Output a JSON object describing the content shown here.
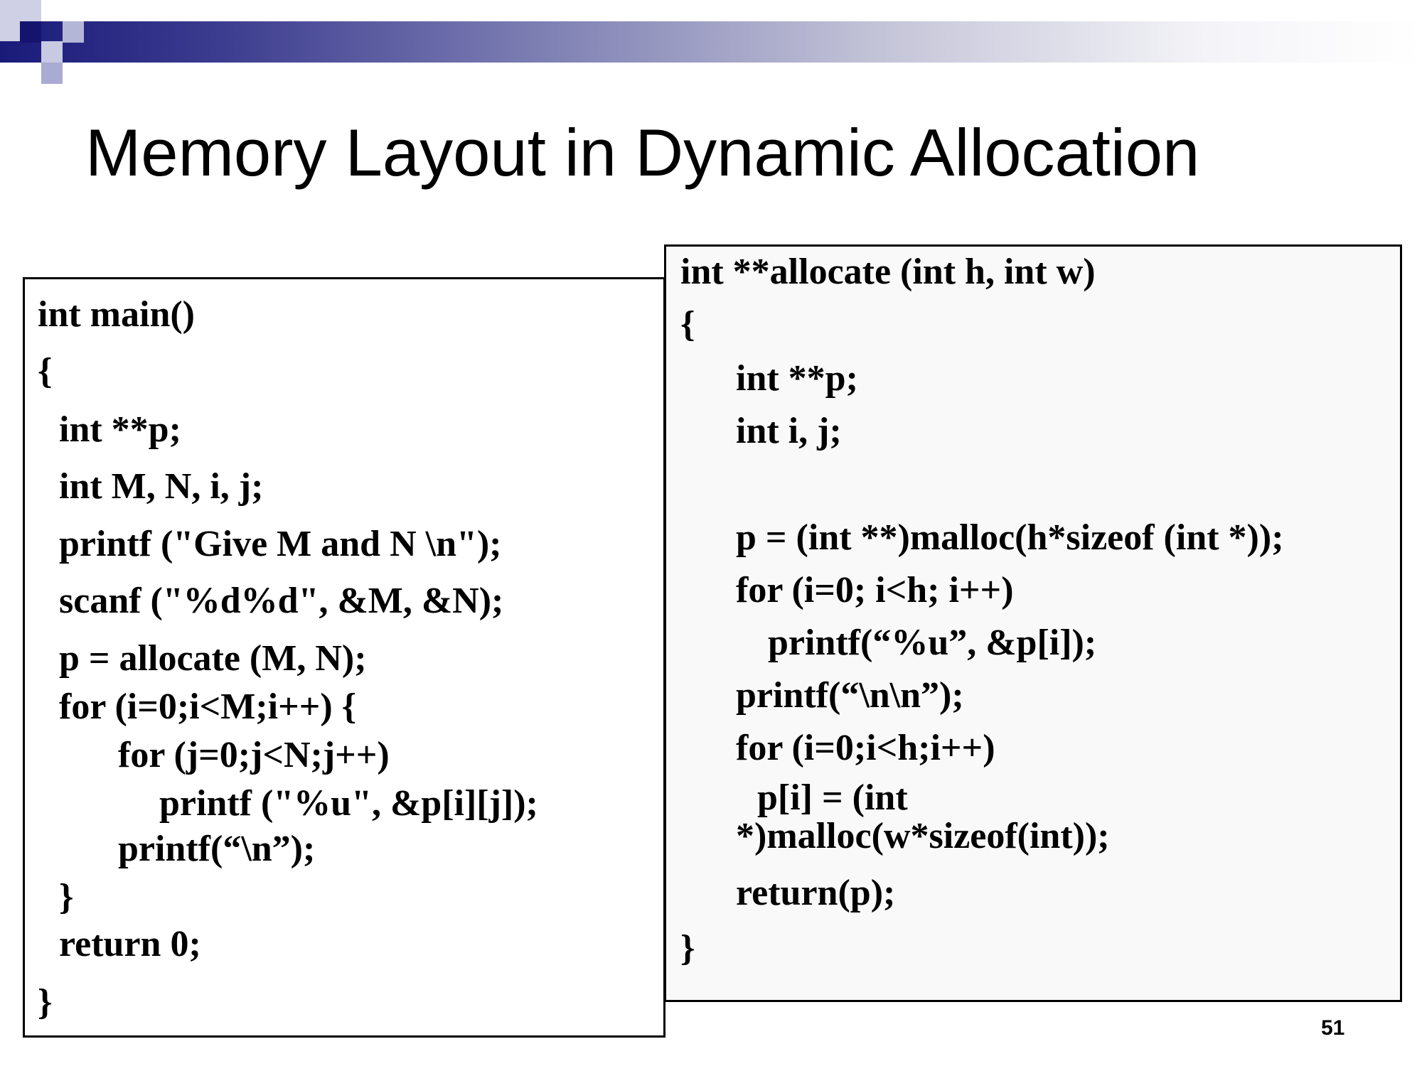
{
  "slide": {
    "title": "Memory Layout in Dynamic Allocation",
    "page_number": "51"
  },
  "code_main": {
    "lines": [
      "int main()",
      "{",
      "int **p;",
      "int M, N, i, j;",
      "printf (\"Give M and N \\n\");",
      "scanf (\"%d%d\", &M, &N);",
      "p = allocate (M, N);",
      "for (i=0;i<M;i++) {",
      "for (j=0;j<N;j++)",
      "printf (\"%u\", &p[i][j]);",
      "printf(“\\n”);",
      "}",
      "return 0;",
      "}"
    ]
  },
  "code_allocate": {
    "lines": [
      "int **allocate (int h, int w)",
      "{",
      "int **p;",
      "int i, j;",
      "p = (int **)malloc(h*sizeof (int *));",
      "for (i=0; i<h; i++)",
      "printf(“%u”, &p[i]);",
      "printf(“\\n\\n”);",
      "for (i=0;i<h;i++)",
      "p[i] = (int",
      "*)malloc(w*sizeof(int));",
      "return(p);",
      "}"
    ]
  },
  "theme": {
    "accent_dark": "#1a1a7a",
    "accent_mid": "#7d7fb3",
    "accent_light": "#b8b8d8"
  }
}
